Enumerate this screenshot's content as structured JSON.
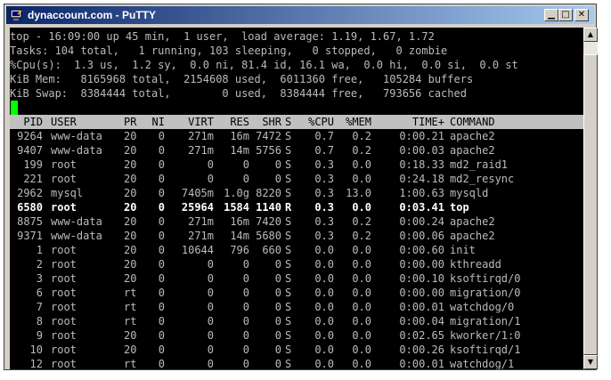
{
  "window": {
    "title": "dynaccount.com - PuTTY"
  },
  "summary": [
    "top - 16:09:00 up 45 min,  1 user,  load average: 1.19, 1.67, 1.72",
    "Tasks: 104 total,   1 running, 103 sleeping,   0 stopped,   0 zombie",
    "%Cpu(s):  1.3 us,  1.2 sy,  0.0 ni, 81.4 id, 16.1 wa,  0.0 hi,  0.0 si,  0.0 st",
    "KiB Mem:   8165968 total,  2154608 used,  6011360 free,   105284 buffers",
    "KiB Swap:  8384444 total,        0 used,  8384444 free,   793656 cached"
  ],
  "columns": [
    "PID",
    "USER",
    "PR",
    "NI",
    "VIRT",
    "RES",
    "SHR",
    "S",
    "%CPU",
    "%MEM",
    "TIME+",
    "COMMAND"
  ],
  "processes": [
    {
      "pid": "9264",
      "user": "www-data",
      "pr": "20",
      "ni": "0",
      "virt": "271m",
      "res": "16m",
      "shr": "7472",
      "s": "S",
      "cpu": "0.7",
      "mem": "0.2",
      "time": "0:00.21",
      "cmd": "apache2"
    },
    {
      "pid": "9407",
      "user": "www-data",
      "pr": "20",
      "ni": "0",
      "virt": "271m",
      "res": "14m",
      "shr": "5756",
      "s": "S",
      "cpu": "0.7",
      "mem": "0.2",
      "time": "0:00.03",
      "cmd": "apache2"
    },
    {
      "pid": "199",
      "user": "root",
      "pr": "20",
      "ni": "0",
      "virt": "0",
      "res": "0",
      "shr": "0",
      "s": "S",
      "cpu": "0.3",
      "mem": "0.0",
      "time": "0:18.33",
      "cmd": "md2_raid1"
    },
    {
      "pid": "221",
      "user": "root",
      "pr": "20",
      "ni": "0",
      "virt": "0",
      "res": "0",
      "shr": "0",
      "s": "S",
      "cpu": "0.3",
      "mem": "0.0",
      "time": "0:24.18",
      "cmd": "md2_resync"
    },
    {
      "pid": "2962",
      "user": "mysql",
      "pr": "20",
      "ni": "0",
      "virt": "7405m",
      "res": "1.0g",
      "shr": "8220",
      "s": "S",
      "cpu": "0.3",
      "mem": "13.0",
      "time": "1:00.63",
      "cmd": "mysqld"
    },
    {
      "pid": "6580",
      "user": "root",
      "pr": "20",
      "ni": "0",
      "virt": "25964",
      "res": "1584",
      "shr": "1140",
      "s": "R",
      "cpu": "0.3",
      "mem": "0.0",
      "time": "0:03.41",
      "cmd": "top",
      "bold": true
    },
    {
      "pid": "8875",
      "user": "www-data",
      "pr": "20",
      "ni": "0",
      "virt": "271m",
      "res": "16m",
      "shr": "7420",
      "s": "S",
      "cpu": "0.3",
      "mem": "0.2",
      "time": "0:00.24",
      "cmd": "apache2"
    },
    {
      "pid": "9371",
      "user": "www-data",
      "pr": "20",
      "ni": "0",
      "virt": "271m",
      "res": "14m",
      "shr": "5680",
      "s": "S",
      "cpu": "0.3",
      "mem": "0.2",
      "time": "0:00.06",
      "cmd": "apache2"
    },
    {
      "pid": "1",
      "user": "root",
      "pr": "20",
      "ni": "0",
      "virt": "10644",
      "res": "796",
      "shr": "660",
      "s": "S",
      "cpu": "0.0",
      "mem": "0.0",
      "time": "0:00.60",
      "cmd": "init"
    },
    {
      "pid": "2",
      "user": "root",
      "pr": "20",
      "ni": "0",
      "virt": "0",
      "res": "0",
      "shr": "0",
      "s": "S",
      "cpu": "0.0",
      "mem": "0.0",
      "time": "0:00.00",
      "cmd": "kthreadd"
    },
    {
      "pid": "3",
      "user": "root",
      "pr": "20",
      "ni": "0",
      "virt": "0",
      "res": "0",
      "shr": "0",
      "s": "S",
      "cpu": "0.0",
      "mem": "0.0",
      "time": "0:00.10",
      "cmd": "ksoftirqd/0"
    },
    {
      "pid": "6",
      "user": "root",
      "pr": "rt",
      "ni": "0",
      "virt": "0",
      "res": "0",
      "shr": "0",
      "s": "S",
      "cpu": "0.0",
      "mem": "0.0",
      "time": "0:00.00",
      "cmd": "migration/0"
    },
    {
      "pid": "7",
      "user": "root",
      "pr": "rt",
      "ni": "0",
      "virt": "0",
      "res": "0",
      "shr": "0",
      "s": "S",
      "cpu": "0.0",
      "mem": "0.0",
      "time": "0:00.01",
      "cmd": "watchdog/0"
    },
    {
      "pid": "8",
      "user": "root",
      "pr": "rt",
      "ni": "0",
      "virt": "0",
      "res": "0",
      "shr": "0",
      "s": "S",
      "cpu": "0.0",
      "mem": "0.0",
      "time": "0:00.04",
      "cmd": "migration/1"
    },
    {
      "pid": "9",
      "user": "root",
      "pr": "20",
      "ni": "0",
      "virt": "0",
      "res": "0",
      "shr": "0",
      "s": "S",
      "cpu": "0.0",
      "mem": "0.0",
      "time": "0:02.65",
      "cmd": "kworker/1:0"
    },
    {
      "pid": "10",
      "user": "root",
      "pr": "20",
      "ni": "0",
      "virt": "0",
      "res": "0",
      "shr": "0",
      "s": "S",
      "cpu": "0.0",
      "mem": "0.0",
      "time": "0:00.26",
      "cmd": "ksoftirqd/1"
    },
    {
      "pid": "12",
      "user": "root",
      "pr": "rt",
      "ni": "0",
      "virt": "0",
      "res": "0",
      "shr": "0",
      "s": "S",
      "cpu": "0.0",
      "mem": "0.0",
      "time": "0:00.01",
      "cmd": "watchdog/1"
    }
  ],
  "icons": {
    "app": "putty-icon",
    "minimize": "minimize-icon",
    "maximize": "maximize-icon",
    "close": "close-icon",
    "scroll_up": "scroll-up-arrow-icon",
    "scroll_down": "scroll-down-arrow-icon"
  },
  "colors": {
    "title_start": "#0a246a",
    "title_end": "#a6caf0",
    "terminal_bg": "#000000",
    "text": "#bbbbbb",
    "cursor": "#00ff00",
    "header_bg": "#c0c0c0"
  }
}
